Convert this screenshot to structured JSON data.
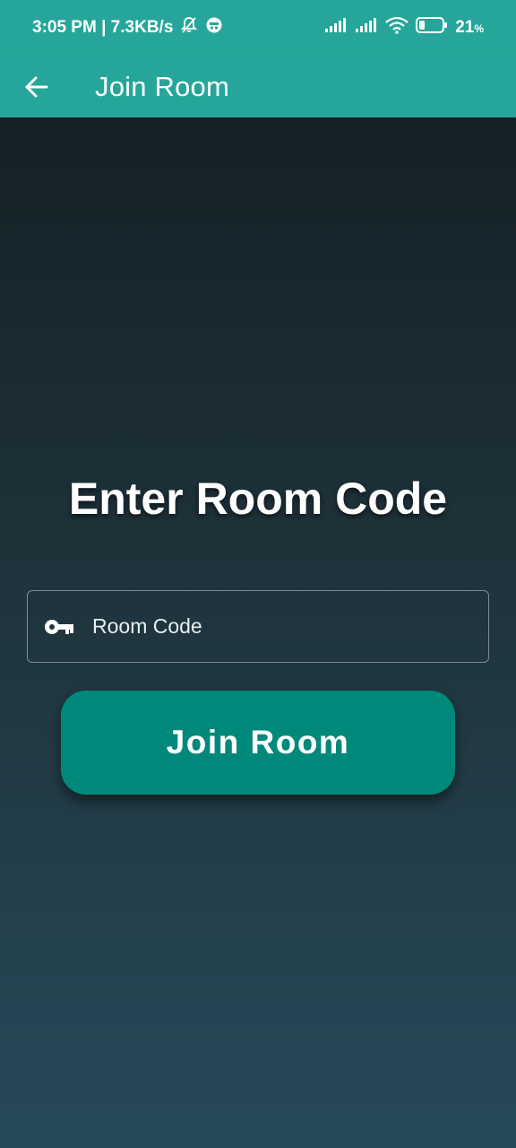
{
  "status_bar": {
    "time_info": "3:05 PM | 7.3KB/s",
    "battery_level": "21",
    "battery_unit": "%",
    "icons": [
      "bell-off-icon",
      "app-notification-icon",
      "signal-icon",
      "signal-icon",
      "wifi-icon",
      "battery-icon"
    ]
  },
  "app_bar": {
    "title": "Join Room",
    "back_icon": "arrow-left-icon",
    "color": "#26a69a"
  },
  "main": {
    "heading": "Enter Room Code",
    "room_code_input": {
      "value": "",
      "placeholder": "Room Code",
      "icon": "key-icon"
    },
    "join_button_label": "Join Room",
    "button_color": "#00897b"
  }
}
